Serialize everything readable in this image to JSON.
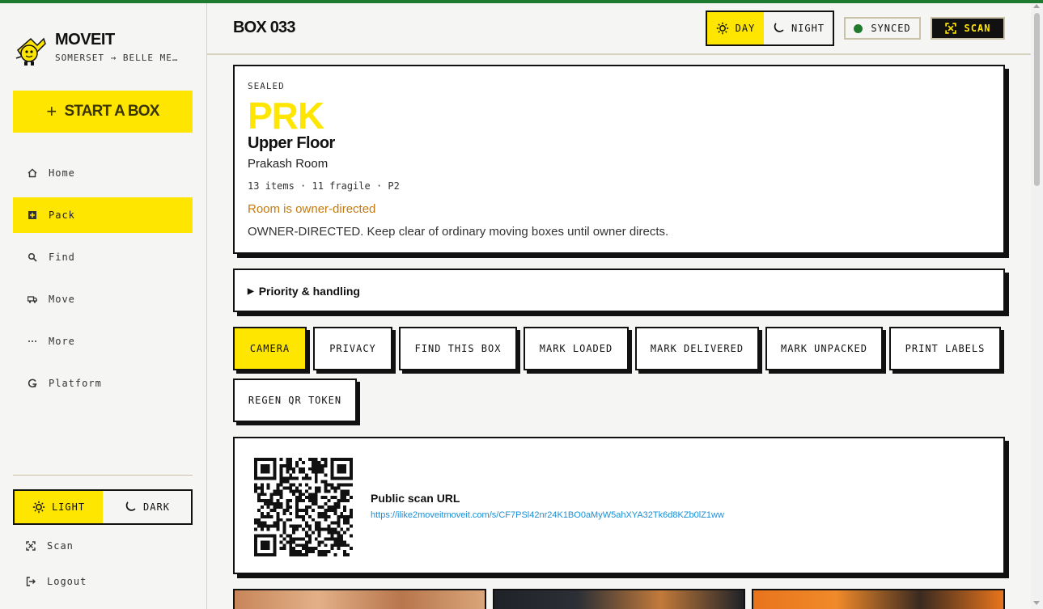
{
  "app": {
    "name": "MOVEIT",
    "subtitle": "SOMERSET → BELLE ME…",
    "accent": "#ffe600",
    "success": "#1e7a2e"
  },
  "sidebar": {
    "start_label": "START A BOX",
    "start_icon": "plus-icon",
    "items": [
      {
        "label": "Home",
        "icon": "home-icon",
        "active": false
      },
      {
        "label": "Pack",
        "icon": "pack-icon",
        "active": true
      },
      {
        "label": "Find",
        "icon": "search-icon",
        "active": false
      },
      {
        "label": "Move",
        "icon": "truck-icon",
        "active": false
      },
      {
        "label": "More",
        "icon": "more-icon",
        "active": false
      },
      {
        "label": "Platform",
        "icon": "platform-icon",
        "active": false
      }
    ],
    "theme": {
      "light": "LIGHT",
      "dark": "DARK",
      "selected": "light"
    },
    "scan_label": "Scan",
    "logout_label": "Logout"
  },
  "header": {
    "title": "BOX 033",
    "day_label": "DAY",
    "night_label": "NIGHT",
    "synced_label": "SYNCED",
    "scan_label": "SCAN"
  },
  "box": {
    "status": "SEALED",
    "room_code": "PRK",
    "floor": "Upper Floor",
    "room_name": "Prakash Room",
    "meta": "13 items · 11 fragile · P2",
    "owner_note": "Room is owner-directed",
    "owner_desc": "OWNER-DIRECTED. Keep clear of ordinary moving boxes until owner directs."
  },
  "priority": {
    "summary": "Priority & handling"
  },
  "actions": [
    "CAMERA",
    "PRIVACY",
    "FIND THIS BOX",
    "MARK LOADED",
    "MARK DELIVERED",
    "MARK UNPACKED",
    "PRINT LABELS",
    "REGEN QR TOKEN"
  ],
  "qr": {
    "title": "Public scan URL",
    "url": "https://ilike2moveitmoveit.com/s/CF7PSl42nr24K1BO0aMyW5ahXYA32Tk6d8KZb0lZ1ww"
  }
}
